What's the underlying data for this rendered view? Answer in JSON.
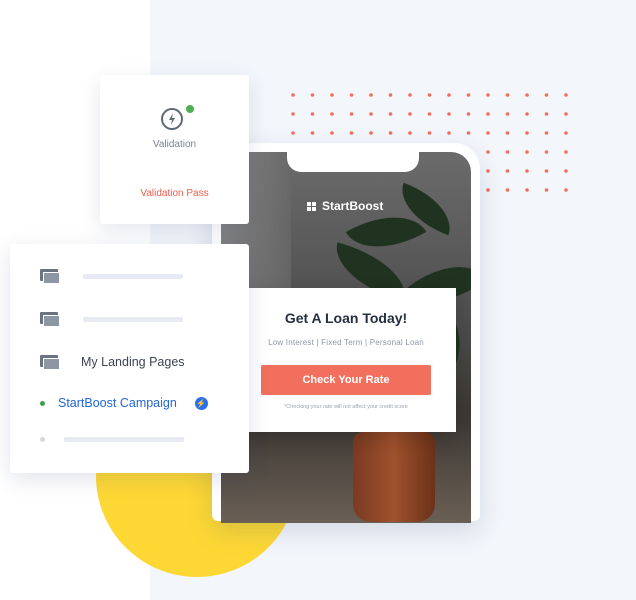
{
  "validation": {
    "label": "Validation",
    "status": "Validation Pass",
    "icon": "lightning-icon",
    "status_dot_color": "#4caf50"
  },
  "phone": {
    "brand": "StartBoost",
    "brand_icon": "grid-logo-icon",
    "card": {
      "title": "Get A Loan Today!",
      "subtitle": "Low Interest | Fixed Term | Personal Loan",
      "button_label": "Check Your Rate",
      "note": "*Checking your rate will not affect your credit score"
    }
  },
  "pages_list": {
    "items": [
      {
        "icon": "folder-icon",
        "label": ""
      },
      {
        "icon": "folder-icon",
        "label": ""
      },
      {
        "icon": "folder-icon",
        "label": "My Landing Pages"
      },
      {
        "icon": "green-dot",
        "label": "StartBoost Campaign",
        "badge_icon": "lightning-icon"
      },
      {
        "icon": "grey-dot",
        "label": ""
      }
    ]
  },
  "colors": {
    "accent_red": "#f26f5d",
    "link_blue": "#2266d8",
    "yellow": "#fdd835",
    "background_panel": "#f3f6fb"
  }
}
